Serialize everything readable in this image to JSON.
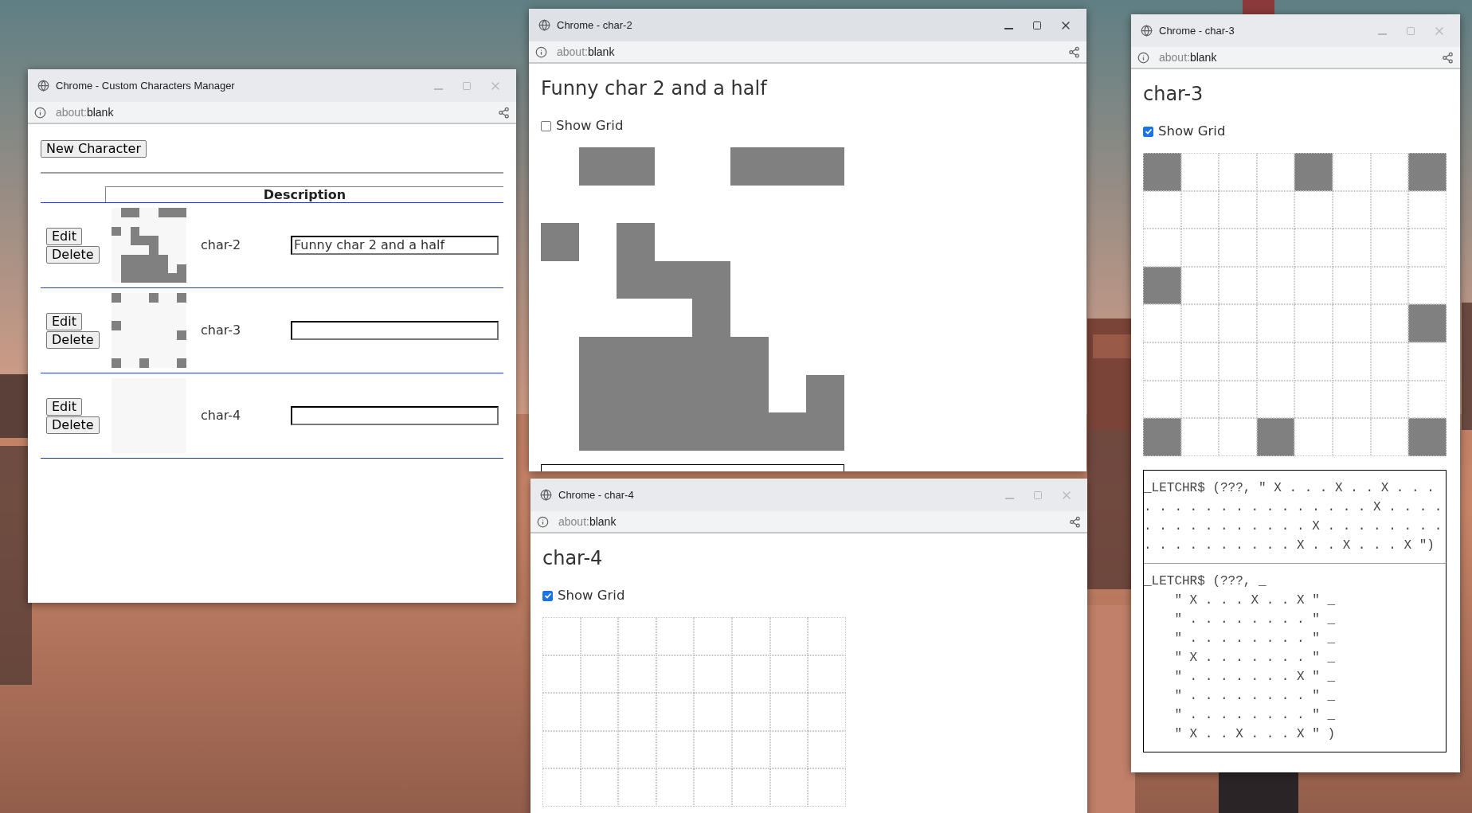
{
  "windows": [
    {
      "kind": "manager",
      "title": "Chrome - Custom Characters Manager",
      "focused": false,
      "url_scheme": "about:",
      "url_path": "blank",
      "new_button": "New Character",
      "column_header": "Description",
      "characters": [
        {
          "edit": "Edit",
          "delete": "Delete",
          "name": "char-2",
          "description": "Funny char 2 and a half",
          "pattern": [
            [
              false,
              true,
              true,
              false,
              false,
              true,
              true,
              true
            ],
            [
              false,
              false,
              false,
              false,
              false,
              false,
              false,
              false
            ],
            [
              true,
              false,
              true,
              false,
              false,
              false,
              false,
              false
            ],
            [
              false,
              false,
              true,
              true,
              true,
              false,
              false,
              false
            ],
            [
              false,
              false,
              false,
              false,
              true,
              false,
              false,
              false
            ],
            [
              false,
              true,
              true,
              true,
              true,
              true,
              false,
              false
            ],
            [
              false,
              true,
              true,
              true,
              true,
              true,
              false,
              true
            ],
            [
              false,
              true,
              true,
              true,
              true,
              true,
              true,
              true
            ]
          ]
        },
        {
          "edit": "Edit",
          "delete": "Delete",
          "name": "char-3",
          "pattern": [
            [
              true,
              false,
              false,
              false,
              true,
              false,
              false,
              true
            ],
            [
              false,
              false,
              false,
              false,
              false,
              false,
              false,
              false
            ],
            [
              false,
              false,
              false,
              false,
              false,
              false,
              false,
              false
            ],
            [
              true,
              false,
              false,
              false,
              false,
              false,
              false,
              false
            ],
            [
              false,
              false,
              false,
              false,
              false,
              false,
              false,
              true
            ],
            [
              false,
              false,
              false,
              false,
              false,
              false,
              false,
              false
            ],
            [
              false,
              false,
              false,
              false,
              false,
              false,
              false,
              false
            ],
            [
              true,
              false,
              false,
              true,
              false,
              false,
              false,
              true
            ]
          ]
        },
        {
          "edit": "Edit",
          "delete": "Delete",
          "name": "char-4",
          "pattern": [
            [
              false,
              false,
              false,
              false,
              false,
              false,
              false,
              false
            ],
            [
              false,
              false,
              false,
              false,
              false,
              false,
              false,
              false
            ],
            [
              false,
              false,
              false,
              false,
              false,
              false,
              false,
              false
            ],
            [
              false,
              false,
              false,
              false,
              false,
              false,
              false,
              false
            ],
            [
              false,
              false,
              false,
              false,
              false,
              false,
              false,
              false
            ],
            [
              false,
              false,
              false,
              false,
              false,
              false,
              false,
              false
            ],
            [
              false,
              false,
              false,
              false,
              false,
              false,
              false,
              false
            ],
            [
              false,
              false,
              false,
              false,
              false,
              false,
              false,
              false
            ]
          ]
        }
      ]
    },
    {
      "kind": "editor",
      "title": "Chrome - char-2",
      "focused": true,
      "url_scheme": "about:",
      "url_path": "blank",
      "heading": "Funny char 2 and a half",
      "code_box": true,
      "show_grid": {
        "label": "Show Grid",
        "checked": false
      },
      "pattern": [
        [
          false,
          true,
          true,
          false,
          false,
          true,
          true,
          true
        ],
        [
          false,
          false,
          false,
          false,
          false,
          false,
          false,
          false
        ],
        [
          true,
          false,
          true,
          false,
          false,
          false,
          false,
          false
        ],
        [
          false,
          false,
          true,
          true,
          true,
          false,
          false,
          false
        ],
        [
          false,
          false,
          false,
          false,
          true,
          false,
          false,
          false
        ],
        [
          false,
          true,
          true,
          true,
          true,
          true,
          false,
          false
        ],
        [
          false,
          true,
          true,
          true,
          true,
          true,
          false,
          true
        ],
        [
          false,
          true,
          true,
          true,
          true,
          true,
          true,
          true
        ]
      ]
    },
    {
      "kind": "editor",
      "title": "Chrome - char-3",
      "focused": false,
      "url_scheme": "about:",
      "url_path": "blank",
      "heading": "char-3",
      "code_box": true,
      "show_grid": {
        "label": "Show Grid",
        "checked": true
      },
      "pattern": [
        [
          true,
          false,
          false,
          false,
          true,
          false,
          false,
          true
        ],
        [
          false,
          false,
          false,
          false,
          false,
          false,
          false,
          false
        ],
        [
          false,
          false,
          false,
          false,
          false,
          false,
          false,
          false
        ],
        [
          true,
          false,
          false,
          false,
          false,
          false,
          false,
          false
        ],
        [
          false,
          false,
          false,
          false,
          false,
          false,
          false,
          true
        ],
        [
          false,
          false,
          false,
          false,
          false,
          false,
          false,
          false
        ],
        [
          false,
          false,
          false,
          false,
          false,
          false,
          false,
          false
        ],
        [
          true,
          false,
          false,
          true,
          false,
          false,
          false,
          true
        ]
      ],
      "code_blocks": [
        {
          "lines": [
            "_LETCHR$ (???, \" X . . . X . . X . . . . . . . . . . . . . . . . . . X . . . . . . . . . . . . . . . X . . . . . . . . . . . . . . . . . . X . . X . . . X \")"
          ]
        },
        {
          "lines": [
            "_LETCHR$ (???, _",
            "    \" X . . . X . . X \" _",
            "    \" . . . . . . . . \" _",
            "    \" . . . . . . . . \" _",
            "    \" X . . . . . . . \" _",
            "    \" . . . . . . . X \" _",
            "    \" . . . . . . . . \" _",
            "    \" . . . . . . . . \" _",
            "    \" X . . X . . . X \" )"
          ]
        }
      ]
    },
    {
      "kind": "editor",
      "title": "Chrome - char-4",
      "focused": false,
      "url_scheme": "about:",
      "url_path": "blank",
      "heading": "char-4",
      "show_grid": {
        "label": "Show Grid",
        "checked": true
      },
      "pattern": [
        [
          false,
          false,
          false,
          false,
          false,
          false,
          false,
          false
        ],
        [
          false,
          false,
          false,
          false,
          false,
          false,
          false,
          false
        ],
        [
          false,
          false,
          false,
          false,
          false,
          false,
          false,
          false
        ],
        [
          false,
          false,
          false,
          false,
          false,
          false,
          false,
          false
        ],
        [
          false,
          false,
          false,
          false,
          false,
          false,
          false,
          false
        ]
      ]
    }
  ]
}
